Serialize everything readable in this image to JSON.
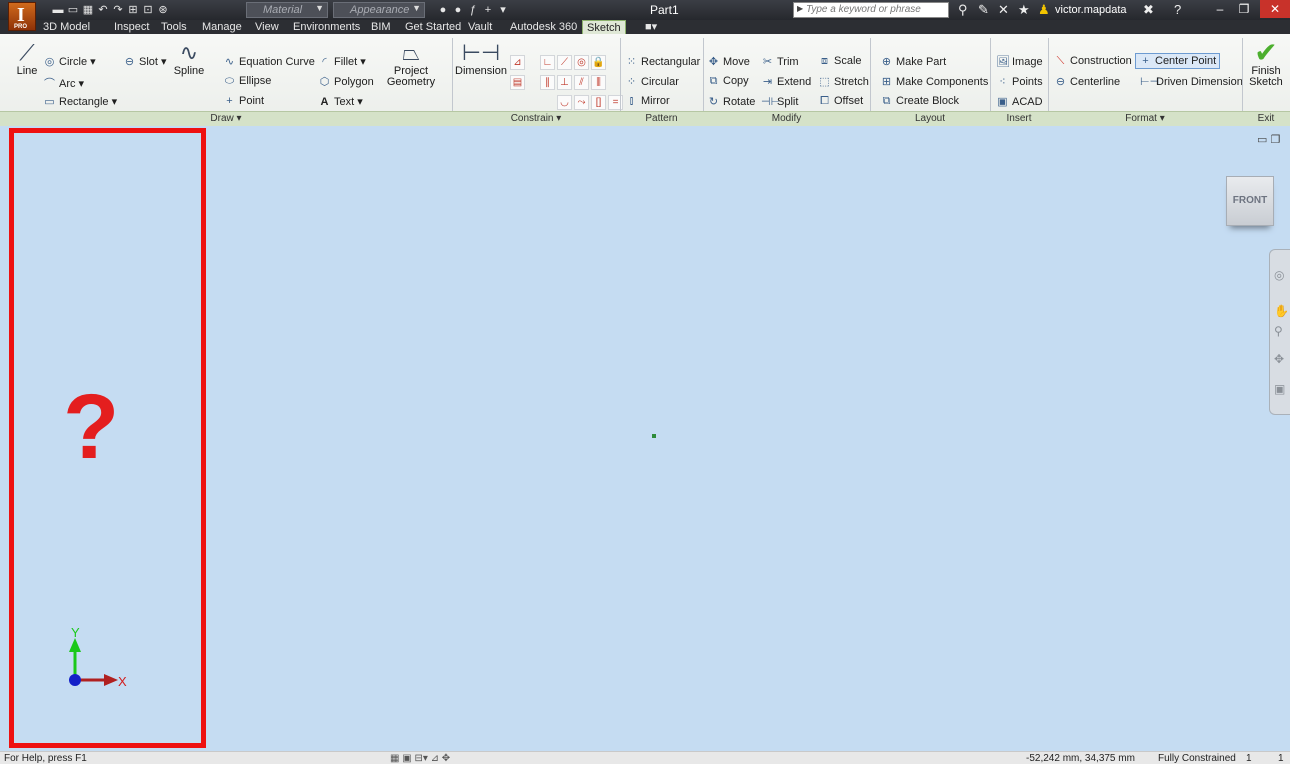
{
  "titlebar": {
    "title": "Part1",
    "material_placeholder": "Material",
    "appearance_placeholder": "Appearance",
    "search_placeholder": "Type a keyword or phrase",
    "user": "victor.mapdata",
    "logo_text": "I",
    "logo_edition": "PRO"
  },
  "tabs": [
    "3D Model",
    "Inspect",
    "Tools",
    "Manage",
    "View",
    "Environments",
    "BIM",
    "Get Started",
    "Vault",
    "Autodesk 360",
    "Sketch"
  ],
  "active_tab": "Sketch",
  "ribbon": {
    "draw": {
      "line": "Line",
      "circle": "Circle",
      "arc": "Arc",
      "rectangle": "Rectangle",
      "slot": "Slot",
      "spline": "Spline",
      "equation_curve": "Equation Curve",
      "ellipse": "Ellipse",
      "point": "Point",
      "fillet": "Fillet",
      "polygon": "Polygon",
      "text": "Text",
      "project_geometry_1": "Project",
      "project_geometry_2": "Geometry"
    },
    "constrain": {
      "dimension": "Dimension"
    },
    "pattern": {
      "rectangular": "Rectangular",
      "circular": "Circular",
      "mirror": "Mirror"
    },
    "modify": {
      "move": "Move",
      "trim": "Trim",
      "scale": "Scale",
      "copy": "Copy",
      "extend": "Extend",
      "stretch": "Stretch",
      "rotate": "Rotate",
      "split": "Split",
      "offset": "Offset"
    },
    "layout": {
      "make_part": "Make Part",
      "make_components": "Make Components",
      "create_block": "Create Block"
    },
    "insert": {
      "image": "Image",
      "points": "Points",
      "acad": "ACAD"
    },
    "format": {
      "construction": "Construction",
      "center_point": "Center Point",
      "centerline": "Centerline",
      "driven_dimension": "Driven Dimension"
    },
    "exit": {
      "finish_1": "Finish",
      "finish_2": "Sketch"
    },
    "panels": [
      "Draw",
      "Constrain",
      "Pattern",
      "Modify",
      "Layout",
      "Insert",
      "Format",
      "Exit"
    ]
  },
  "canvas": {
    "viewcube_face": "FRONT",
    "overlay_mark": "?",
    "axis_y": "Y",
    "axis_x": "X"
  },
  "statusbar": {
    "help": "For Help, press F1",
    "coords": "-52,242 mm, 34,375 mm",
    "constraint_status": "Fully Constrained",
    "count_1": "1",
    "count_2": "1"
  },
  "colors": {
    "highlight_box": "#ee1111",
    "canvas_bg": "#c5dcf2",
    "sketch_tab": "#dfe8d6"
  }
}
